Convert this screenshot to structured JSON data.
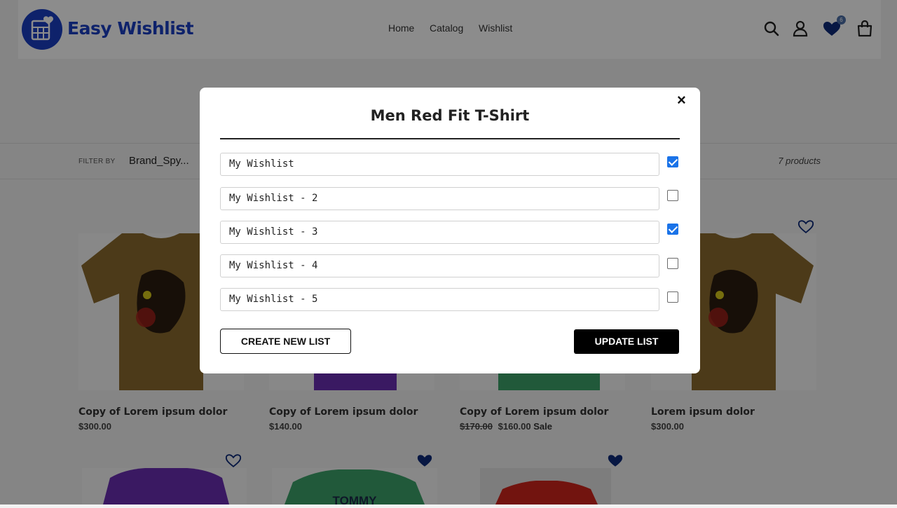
{
  "header": {
    "brand": "Easy Wishlist",
    "nav": [
      "Home",
      "Catalog",
      "Wishlist"
    ],
    "wishlist_count": "6"
  },
  "collection": {
    "filter_label": "FILTER BY",
    "filter_value": "Brand_Spy...",
    "count": "7 products"
  },
  "products": [
    {
      "name": "Copy of Lorem ipsum dolor",
      "price": "$300.00",
      "shirt_color": "#8a6b2e",
      "image": "anime-print-tshirt"
    },
    {
      "name": "Copy of Lorem ipsum dolor",
      "price": "$140.00",
      "shirt_color": "#6a2fb3",
      "image": "purple-tshirt"
    },
    {
      "name": "Copy of Lorem ipsum dolor",
      "old_price": "$170.00",
      "price": "$160.00",
      "sale": "Sale",
      "shirt_color": "#3ca36a",
      "image": "green-tshirt"
    },
    {
      "name": "Lorem ipsum dolor",
      "price": "$300.00",
      "shirt_color": "#8a6b2e",
      "image": "anime-print-tshirt",
      "heart": "outline"
    },
    {
      "shirt_color": "#6a2fb3",
      "image": "purple-tshirt",
      "heart": "outline"
    },
    {
      "shirt_color": "#3ca36a",
      "image": "tommy-green-tshirt",
      "print": "TOMMY",
      "heart": "filled"
    },
    {
      "shirt_color": "#d0261c",
      "image": "red-tshirt",
      "heart": "filled"
    }
  ],
  "modal": {
    "title": "Men Red Fit T-Shirt",
    "close": "×",
    "lists": [
      {
        "name": "My Wishlist",
        "checked": true
      },
      {
        "name": "My Wishlist - 2",
        "checked": false
      },
      {
        "name": "My Wishlist - 3",
        "checked": true
      },
      {
        "name": "My Wishlist - 4",
        "checked": false
      },
      {
        "name": "My Wishlist - 5",
        "checked": false
      }
    ],
    "create_label": "CREATE NEW LIST",
    "update_label": "UPDATE LIST"
  },
  "colors": {
    "brand": "#1b3fc4",
    "heart": "#0d2b7a",
    "checkbox": "#1a73e8"
  }
}
